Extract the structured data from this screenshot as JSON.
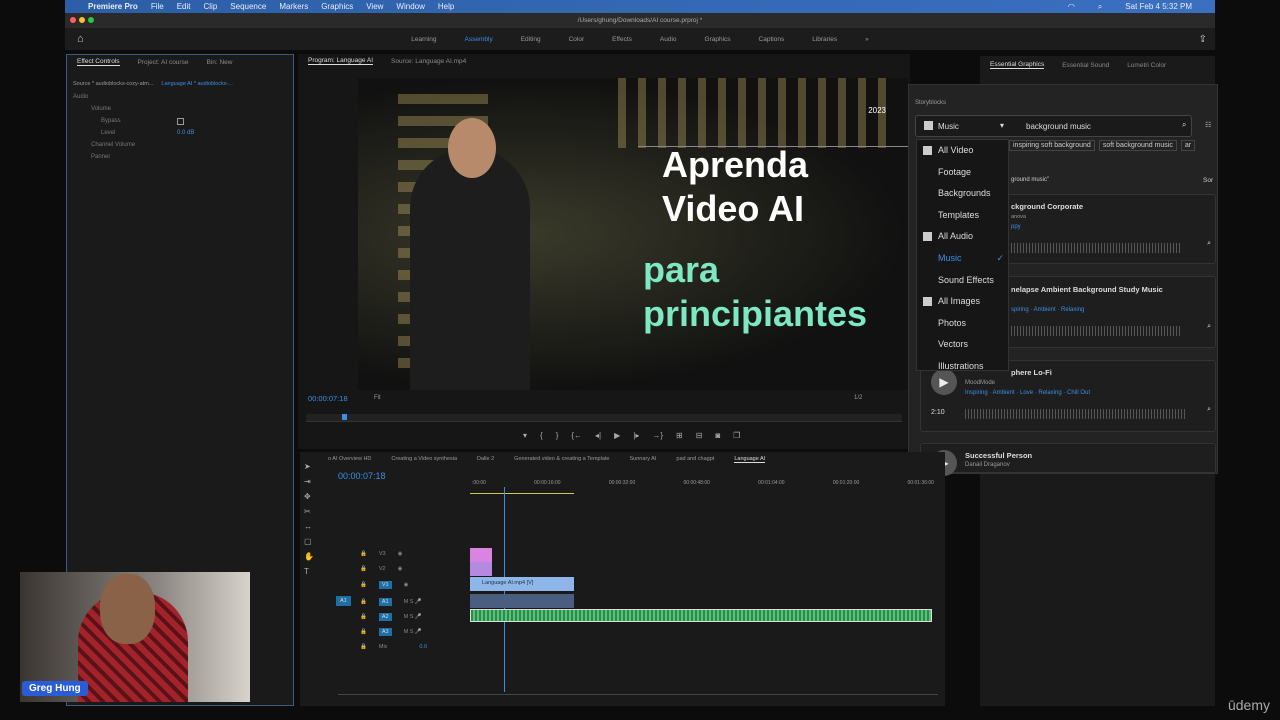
{
  "menubar": {
    "app": "Premiere Pro",
    "items": [
      "File",
      "Edit",
      "Clip",
      "Sequence",
      "Markers",
      "Graphics",
      "View",
      "Window",
      "Help"
    ],
    "datetime": "Sat Feb 4  5:32 PM"
  },
  "window": {
    "path": "/Users/ghung/Downloads/AI course.prproj *"
  },
  "workspaces": {
    "items": [
      "Learning",
      "Assembly",
      "Editing",
      "Color",
      "Effects",
      "Audio",
      "Graphics",
      "Captions",
      "Libraries"
    ],
    "active": "Assembly"
  },
  "effect_controls": {
    "tabs": [
      "Effect Controls",
      "Project: AI course",
      "Bin: New"
    ],
    "source": "Source * audioblocks-cozy-atm...",
    "clip": "Language AI * audioblocks-...",
    "section": "Audio",
    "rows": [
      "Volume",
      "Bypass",
      "Level",
      "Channel Volume",
      "Panner"
    ],
    "level_value": "0.0 dB"
  },
  "program": {
    "tabs": [
      "Program: Language AI",
      "Source: Language AI.mp4"
    ],
    "timecode": "00:00:07:18",
    "fit": "Fit",
    "resolution": "1/2",
    "overlay": {
      "year": "2023",
      "line1": "Aprenda",
      "line2": "Video AI",
      "line3": "para",
      "line4": "principiantes"
    }
  },
  "essential_graphics": {
    "tabs": [
      "Essential Graphics",
      "Essential Sound",
      "Lumetri Color"
    ]
  },
  "storyblocks": {
    "title": "Storyblocks",
    "category": "Music",
    "search": "background music",
    "chips": [
      "inspiring soft background",
      "soft background music",
      "ar"
    ],
    "results_label": "ground music\"",
    "sort": "Sor",
    "menu": [
      {
        "label": "All Video",
        "icon": "video"
      },
      {
        "label": "Footage"
      },
      {
        "label": "Backgrounds"
      },
      {
        "label": "Templates"
      },
      {
        "label": "All Audio",
        "icon": "audio"
      },
      {
        "label": "Music",
        "selected": true
      },
      {
        "label": "Sound Effects"
      },
      {
        "label": "All Images",
        "icon": "image"
      },
      {
        "label": "Photos"
      },
      {
        "label": "Vectors"
      },
      {
        "label": "Illustrations"
      }
    ],
    "results": [
      {
        "title": "ckground Corporate",
        "author": "anova",
        "tags": "ppy"
      },
      {
        "title": "nelapse Ambient Background Study Music",
        "author": "",
        "tags": "spiring · Ambient · Relaxing"
      },
      {
        "title": "phere Lo-Fi",
        "author": "MoodMode",
        "tags": "Inspiring · Ambient · Love · Relaxing · Chill Out",
        "duration": "2:10"
      },
      {
        "title": "Successful Person",
        "author": "Danail Draganov"
      }
    ]
  },
  "timeline": {
    "tabs": [
      "o AI Overview HD",
      "Creating a Video synthesia",
      "Dalle 2",
      "Generated video & creating a Template",
      "Sunnary AI",
      "pad and chagpt",
      "Language AI"
    ],
    "timecode": "00:00:07:18",
    "ruler": [
      ":00:00",
      "00:00:16:00",
      "00:00:32:00",
      "00:00:48:00",
      "00:01:04:00",
      "00:01:20:00",
      "00:01:36:00"
    ],
    "tracks": [
      "V3",
      "V2",
      "V1",
      "A1",
      "A2",
      "A3"
    ],
    "mix": "Mix",
    "mix_value": "0.0",
    "clip": "Language AI.mp4 [V]",
    "src_patch": "A1"
  },
  "webcam": {
    "name": "Greg Hung"
  },
  "watermark": "ūdemy"
}
